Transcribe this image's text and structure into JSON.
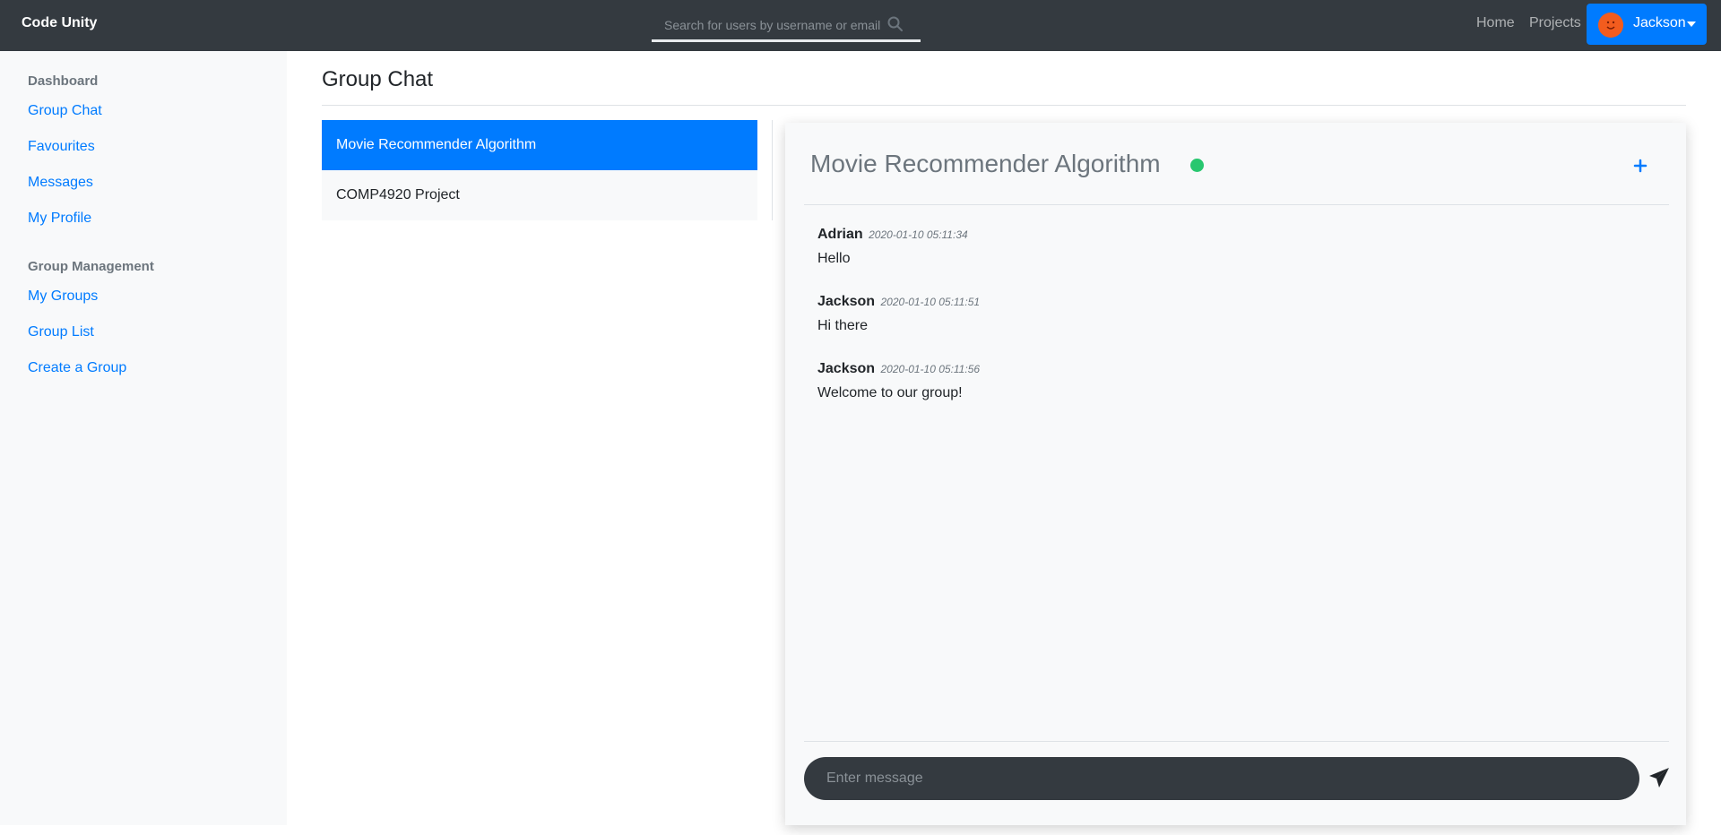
{
  "navbar": {
    "brand": "Code Unity",
    "search_placeholder": "Search for users by username or email",
    "links": {
      "home": "Home",
      "projects": "Projects"
    },
    "user": {
      "name": "Jackson"
    }
  },
  "sidebar": {
    "sections": [
      {
        "heading": "Dashboard",
        "items": [
          "Group Chat",
          "Favourites",
          "Messages",
          "My Profile"
        ]
      },
      {
        "heading": "Group Management",
        "items": [
          "My Groups",
          "Group List",
          "Create a Group"
        ]
      }
    ]
  },
  "main": {
    "title": "Group Chat",
    "groups": [
      {
        "name": "Movie Recommender Algorithm",
        "active": true
      },
      {
        "name": "COMP4920 Project",
        "active": false
      }
    ]
  },
  "chat": {
    "title": "Movie Recommender Algorithm",
    "status_color": "#28c76f",
    "messages": [
      {
        "author": "Adrian",
        "time": "2020-01-10 05:11:34",
        "text": "Hello"
      },
      {
        "author": "Jackson",
        "time": "2020-01-10 05:11:51",
        "text": "Hi there"
      },
      {
        "author": "Jackson",
        "time": "2020-01-10 05:11:56",
        "text": "Welcome to our group!"
      }
    ],
    "input_placeholder": "Enter message"
  },
  "colors": {
    "accent": "#007bff",
    "navbar": "#343a40",
    "sidebar_bg": "#f8f9fa"
  }
}
